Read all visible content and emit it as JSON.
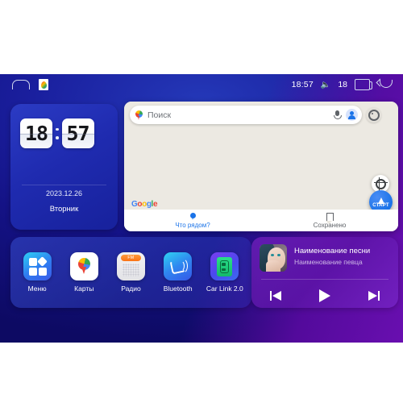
{
  "statusbar": {
    "home_icon": "home-icon",
    "app_icon": "google-maps-icon",
    "time": "18:57",
    "volume_icon": "volume-icon",
    "volume_level": "18",
    "recents_icon": "recent-apps-icon",
    "back_icon": "back-icon"
  },
  "clock_widget": {
    "hours": "18",
    "minutes": "57",
    "date": "2023.12.26",
    "weekday": "Вторник"
  },
  "maps_widget": {
    "search_placeholder": "Поиск",
    "search_value": "",
    "pin_icon": "google-maps-pin-icon",
    "mic_icon": "microphone-icon",
    "avatar_icon": "account-avatar-icon",
    "settings_icon": "map-settings-icon",
    "logo": {
      "g1": "G",
      "g2": "o",
      "g3": "o",
      "g4": "g",
      "g5": "l",
      "g6": "e"
    },
    "my_location_icon": "my-location-icon",
    "start_button_label": "СТАРТ",
    "tabs": [
      {
        "label": "Что рядом?",
        "icon": "location-pin-icon",
        "active": true
      },
      {
        "label": "Сохранено",
        "icon": "bookmark-icon",
        "active": false
      }
    ]
  },
  "dock": {
    "apps": [
      {
        "label": "Меню",
        "icon": "apps-grid-icon"
      },
      {
        "label": "Карты",
        "icon": "google-maps-icon"
      },
      {
        "label": "Радио",
        "icon": "fm-radio-icon",
        "badge": "FM"
      },
      {
        "label": "Bluetooth",
        "icon": "bluetooth-phone-icon"
      },
      {
        "label": "Car Link 2.0",
        "icon": "car-link-icon"
      }
    ]
  },
  "music_widget": {
    "album_art": "album-art-portrait",
    "title": "Наименование песни",
    "artist": "Наименование певца",
    "controls": [
      {
        "name": "previous-track-button",
        "icon": "skip-previous-icon"
      },
      {
        "name": "play-button",
        "icon": "play-icon"
      },
      {
        "name": "next-track-button",
        "icon": "skip-next-icon"
      }
    ]
  },
  "colors": {
    "accent_blue": "#1a73e8",
    "bg_blue": "#1a1f9e",
    "bg_purple": "#5c12a0",
    "map_bg": "#ece9e2",
    "orange": "#f97316"
  }
}
